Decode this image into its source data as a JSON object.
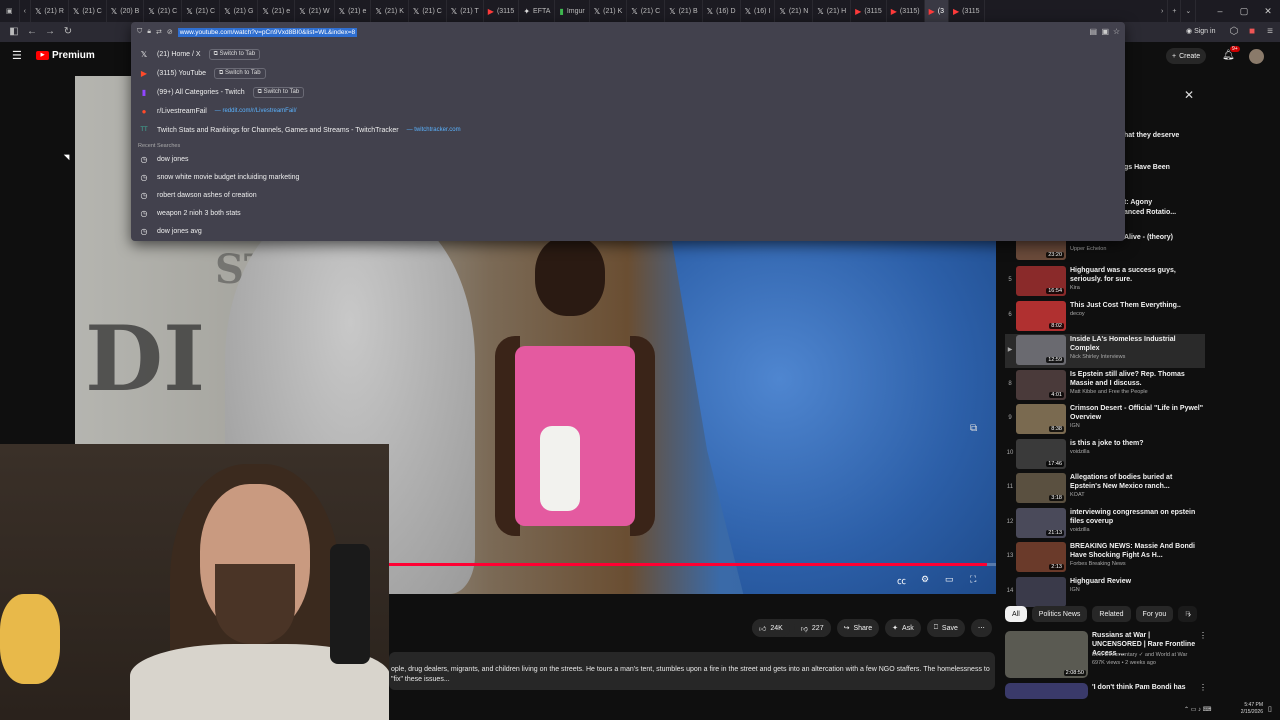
{
  "browser": {
    "tabs": [
      {
        "label": "(21) R",
        "icon": "x-icon"
      },
      {
        "label": "(21) C",
        "icon": "x-icon"
      },
      {
        "label": "(20) B",
        "icon": "x-icon"
      },
      {
        "label": "(21) C",
        "icon": "x-icon"
      },
      {
        "label": "(21) C",
        "icon": "x-icon"
      },
      {
        "label": "(21) G",
        "icon": "x-icon"
      },
      {
        "label": "(21) e",
        "icon": "x-icon"
      },
      {
        "label": "(21) W",
        "icon": "x-icon"
      },
      {
        "label": "(21) e",
        "icon": "x-icon"
      },
      {
        "label": "(21) K",
        "icon": "x-icon"
      },
      {
        "label": "(21) C",
        "icon": "x-icon"
      },
      {
        "label": "(21) T",
        "icon": "x-icon"
      },
      {
        "label": "(3115",
        "icon": "youtube-icon"
      },
      {
        "label": "EFTA",
        "icon": "star-icon"
      },
      {
        "label": "Imgur",
        "icon": "twitch-icon"
      },
      {
        "label": "(21) K",
        "icon": "x-icon"
      },
      {
        "label": "(21) C",
        "icon": "x-icon"
      },
      {
        "label": "(21) B",
        "icon": "x-icon"
      },
      {
        "label": "(16) D",
        "icon": "x-icon"
      },
      {
        "label": "(16) I",
        "icon": "x-icon"
      },
      {
        "label": "(21) N",
        "icon": "x-icon"
      },
      {
        "label": "(21) H",
        "icon": "x-icon"
      },
      {
        "label": "(3115",
        "icon": "youtube-icon"
      },
      {
        "label": "(3115)",
        "icon": "youtube-icon"
      },
      {
        "label": "(3",
        "icon": "youtube-icon"
      },
      {
        "label": "(3115",
        "icon": "youtube-icon"
      }
    ],
    "url": "www.youtube.com/watch?v=pCn9Vxd8BI0&list=WL&index=8",
    "suggestions": [
      {
        "icon": "x-icon",
        "text": "(21) Home / X",
        "action": "Switch to Tab"
      },
      {
        "icon": "youtube-icon",
        "text": "(3115) YouTube",
        "action": "Switch to Tab"
      },
      {
        "icon": "twitch-icon",
        "text": "(99+) All Categories - Twitch",
        "action": "Switch to Tab"
      },
      {
        "icon": "reddit-icon",
        "text": "r/LivestreamFail",
        "url": "— reddit.com/r/LivestreamFail/"
      },
      {
        "icon": "twitchtracker-icon",
        "text": "Twitch Stats and Rankings for Channels, Games and Streams - TwitchTracker",
        "url": "— twitchtracker.com"
      }
    ],
    "recent_label": "Recent Searches",
    "recent": [
      "dow jones",
      "snow white movie budget incluiding marketing",
      "robert dawson ashes of creation",
      "weapon 2 nioh 3 both stats",
      "dow jones avg"
    ],
    "sign_in": "Sign in"
  },
  "youtube": {
    "logo": "Premium",
    "create": "Create",
    "notif_badge": "9+",
    "player": {
      "progress": 0.99
    },
    "actions": {
      "likes": "24K",
      "dislikes": "227",
      "share": "Share",
      "ask": "Ask",
      "save": "Save"
    },
    "description": "ople, drug dealers, migrants, and children living on the streets. He tours a man's tent, stumbles upon a fire in the street and gets into an altercation with a few NGO staffers. The homelessness to \"fix\" these issues...",
    "partial_titles": [
      "hat they deserve",
      "gs Have Been",
      "t: Agony",
      "anced Rotatio...",
      "Alive - (theory)"
    ],
    "playlist": [
      {
        "idx": "",
        "title": "",
        "channel": "Upper Echelon",
        "dur": "23:20"
      },
      {
        "idx": "5",
        "title": "Highguard was a success guys, seriously. for sure.",
        "channel": "Kira",
        "dur": "16:54"
      },
      {
        "idx": "6",
        "title": "This Just Cost Them Everything..",
        "channel": "decoy",
        "dur": "8:02"
      },
      {
        "idx": "▶",
        "title": "Inside LA's Homeless Industrial Complex",
        "channel": "Nick Shirley Interviews",
        "dur": "12:59"
      },
      {
        "idx": "8",
        "title": "Is Epstein still alive? Rep. Thomas Massie and I discuss.",
        "channel": "Matt Kibbe and Free the People",
        "dur": "4:01"
      },
      {
        "idx": "9",
        "title": "Crimson Desert - Official \"Life in Pywel\" Overview",
        "channel": "IGN",
        "dur": "8:38"
      },
      {
        "idx": "10",
        "title": "is this a joke to them?",
        "channel": "voidzilla",
        "dur": "17:46"
      },
      {
        "idx": "11",
        "title": "Allegations of bodies buried at Epstein's New Mexico ranch...",
        "channel": "KOAT",
        "dur": "3:18"
      },
      {
        "idx": "12",
        "title": "interviewing congressman on epstein files coverup",
        "channel": "voidzilla",
        "dur": "21:13"
      },
      {
        "idx": "13",
        "title": "BREAKING NEWS: Massie And Bondi Have Shocking Fight As H...",
        "channel": "Forbes Breaking News",
        "dur": "2:13"
      },
      {
        "idx": "14",
        "title": "Highguard Review",
        "channel": "IGN",
        "dur": ""
      }
    ],
    "chips": [
      "All",
      "Politics News",
      "Related",
      "For you",
      "R"
    ],
    "recs": [
      {
        "title": "Russians at War | UNCENSORED | Rare Frontline Access ...",
        "channel": "Best Documentary ✓ and World at War",
        "stats": "697K views • 2 weeks ago",
        "dur": "2:08:50"
      },
      {
        "title": "'I don't think Pam Bondi has",
        "channel": "",
        "stats": "",
        "dur": ""
      }
    ]
  },
  "tray": {
    "time": "5:47 PM",
    "date": "2/15/2026"
  },
  "colors": {
    "accent": "#ff0033",
    "url_highlight": "#2f6fd1",
    "panel": "#42414d"
  }
}
